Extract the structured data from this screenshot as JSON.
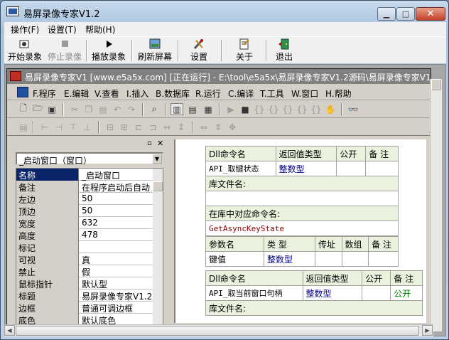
{
  "window": {
    "title": "易屏录像专家V1.2"
  },
  "menubar": [
    "操作(F)",
    "设置(T)",
    "帮助(H)"
  ],
  "toolbar": [
    {
      "label": "开始录象",
      "icon": "record-icon",
      "enabled": true
    },
    {
      "label": "停止录像",
      "icon": "stop-icon",
      "enabled": false
    },
    {
      "label": "播放录象",
      "icon": "play-icon",
      "enabled": true
    },
    {
      "label": "刷新屏幕",
      "icon": "refresh-screen-icon",
      "enabled": true
    },
    {
      "label": "设置",
      "icon": "tools-icon",
      "enabled": true
    },
    {
      "label": "关于",
      "icon": "about-icon",
      "enabled": true
    },
    {
      "label": "退出",
      "icon": "exit-door-icon",
      "enabled": true
    }
  ],
  "child": {
    "title": "易屏录像专家V1 [www.e5a5x.com] [正在运行] - E:\\tool\\e5a5x\\易屏录像专家V1.2源码\\易屏录像专家V1.e",
    "menus": [
      "F.程序",
      "E.编辑",
      "V.查看",
      "I.插入",
      "B.数据库",
      "R.运行",
      "C.编译",
      "T.工具",
      "W.窗口",
      "H.帮助"
    ]
  },
  "properties": {
    "object": "_启动窗口（窗口）",
    "rows": [
      {
        "name": "名称",
        "value": "_启动窗口"
      },
      {
        "name": "备注",
        "value": "在程序启动后自动"
      },
      {
        "name": "左边",
        "value": "50"
      },
      {
        "name": "顶边",
        "value": "50"
      },
      {
        "name": "宽度",
        "value": "632"
      },
      {
        "name": "高度",
        "value": "478"
      },
      {
        "name": "标记",
        "value": ""
      },
      {
        "name": "可视",
        "value": "真"
      },
      {
        "name": "禁止",
        "value": "假"
      },
      {
        "name": "鼠标指针",
        "value": "默认型"
      },
      {
        "name": "标题",
        "value": "易屏录像专家V1.2"
      },
      {
        "name": "边框",
        "value": "普通可调边框"
      },
      {
        "name": "底色",
        "value": "默认底色"
      }
    ]
  },
  "code": {
    "dll1": {
      "h_cmd": "Dll命令名",
      "h_ret": "返回值类型",
      "h_pub": "公开",
      "h_note": "备 注",
      "name": "API_取键状态",
      "ret": "整数型",
      "lib_label": "库文件名:",
      "cmd_label": "在库中对应命令名:",
      "cmd": "GetAsyncKeyState",
      "p_name": "参数名",
      "p_type": "类 型",
      "p_addr": "传址",
      "p_arr": "数组",
      "p_note": "备 注",
      "param": "键值",
      "param_type": "整数型"
    },
    "dll2": {
      "h_cmd": "Dll命令名",
      "h_ret": "返回值类型",
      "h_pub": "公开",
      "h_note": "备 注",
      "name": "API_取当前窗口句柄",
      "ret": "整数型",
      "note": "公开",
      "lib_label": "库文件名:"
    }
  },
  "colors": {
    "accent": "#0a246a",
    "titlebar_inactive": "#808080"
  }
}
